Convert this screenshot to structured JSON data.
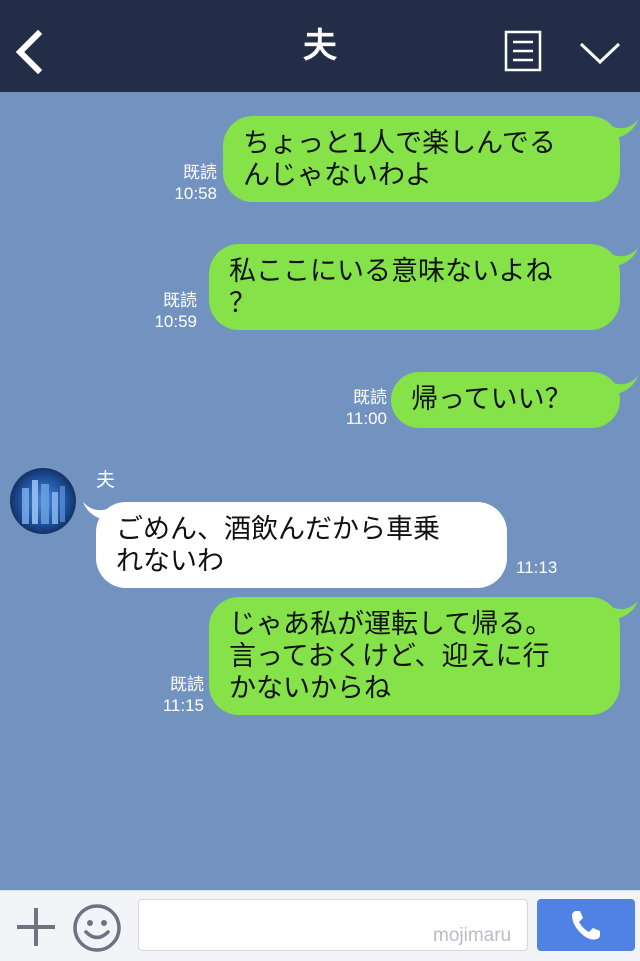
{
  "header": {
    "title": "夫",
    "back_icon": "chevron-left-icon",
    "menu_icon": "list-menu-icon",
    "collapse_icon": "chevron-down-icon"
  },
  "colors": {
    "header_bg": "#232d47",
    "chat_bg": "#7292c0",
    "my_bubble": "#85e249",
    "their_bubble": "#ffffff",
    "call_button": "#4f82e3"
  },
  "messages": [
    {
      "from": "me",
      "text": "ちょっと1人で楽しんでる\nんじゃないわよ",
      "read_label": "既読",
      "time": "10:58"
    },
    {
      "from": "me",
      "text": "私ここにいる意味ないよね\n？",
      "read_label": "既読",
      "time": "10:59"
    },
    {
      "from": "me",
      "text": "帰っていい？",
      "read_label": "既読",
      "time": "11:00"
    },
    {
      "from": "other",
      "sender": "夫",
      "text": "ごめん、酒飲んだから車乗\nれないわ",
      "time": "11:13"
    },
    {
      "from": "me",
      "text": "じゃあ私が運転して帰る。\n言っておくけど、迎えに行\nかないからね",
      "read_label": "既読",
      "time": "11:15"
    }
  ],
  "footer": {
    "input_value": "",
    "watermark": "mojimaru",
    "plus_icon": "plus-icon",
    "emoji_icon": "smiley-icon",
    "call_icon": "phone-icon"
  }
}
